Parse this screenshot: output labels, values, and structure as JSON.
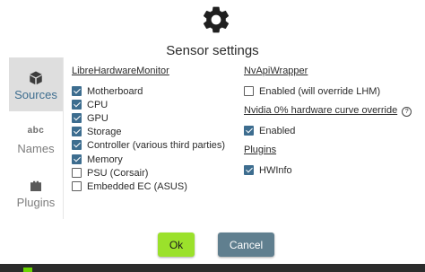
{
  "dialog": {
    "title": "Sensor settings"
  },
  "nav": [
    {
      "label": "Sources",
      "icon": "cube-icon",
      "active": true
    },
    {
      "label": "Names",
      "icon": "abc-icon",
      "icon_text": "abc",
      "active": false
    },
    {
      "label": "Plugins",
      "icon": "plugin-icon",
      "active": false
    }
  ],
  "libre": {
    "heading": "LibreHardwareMonitor",
    "items": [
      {
        "label": "Motherboard",
        "checked": true
      },
      {
        "label": "CPU",
        "checked": true
      },
      {
        "label": "GPU",
        "checked": true
      },
      {
        "label": "Storage",
        "checked": true
      },
      {
        "label": "Controller (various third parties)",
        "checked": true
      },
      {
        "label": "Memory",
        "checked": true
      },
      {
        "label": "PSU (Corsair)",
        "checked": false
      },
      {
        "label": "Embedded EC (ASUS)",
        "checked": false
      }
    ]
  },
  "nvapi": {
    "heading": "NvApiWrapper",
    "item": {
      "label": "Enabled (will override LHM)",
      "checked": false
    }
  },
  "nvidia_curve": {
    "heading": "Nvidia 0% hardware curve override",
    "help_icon": "?",
    "item": {
      "label": "Enabled",
      "checked": true
    }
  },
  "plugins": {
    "heading": "Plugins",
    "item": {
      "label": "HWInfo",
      "checked": true
    }
  },
  "buttons": {
    "ok": "Ok",
    "cancel": "Cancel"
  },
  "colors": {
    "accent": "#3d6d8f",
    "ok_button": "#9be12b",
    "cancel_button": "#607f8f",
    "nav_active_bg": "#dedede"
  }
}
